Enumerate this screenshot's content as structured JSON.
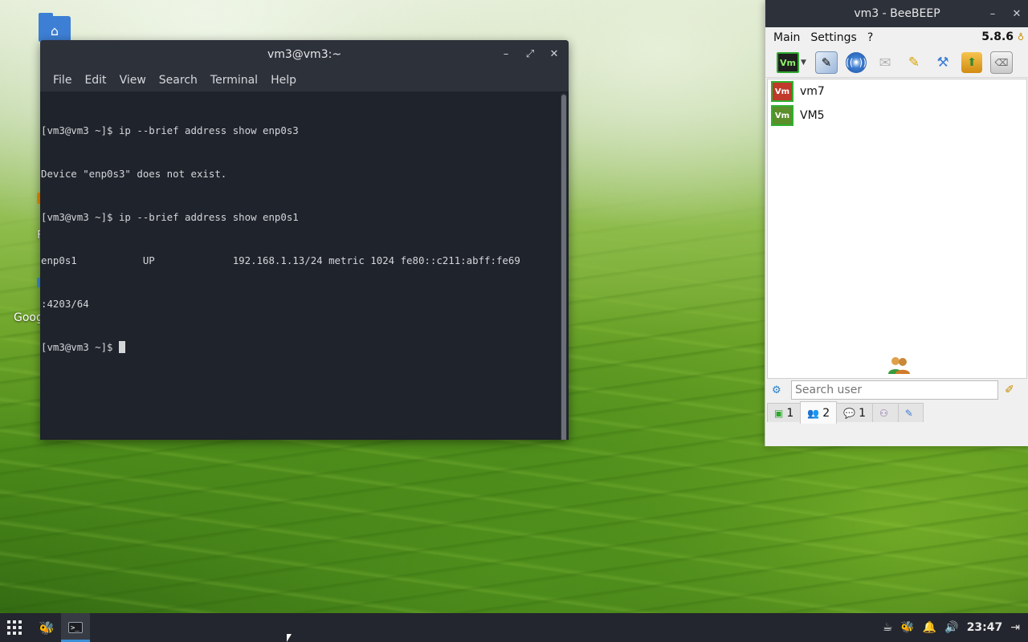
{
  "desktop": {
    "icons": [
      {
        "label": "Goog"
      },
      {
        "label": "F"
      }
    ]
  },
  "terminal": {
    "title": "vm3@vm3:~",
    "menu": [
      "File",
      "Edit",
      "View",
      "Search",
      "Terminal",
      "Help"
    ],
    "lines": [
      "[vm3@vm3 ~]$ ip --brief address show enp0s3",
      "Device \"enp0s3\" does not exist.",
      "[vm3@vm3 ~]$ ip --brief address show enp0s1",
      "enp0s1           UP             192.168.1.13/24 metric 1024 fe80::c211:abff:fe69",
      ":4203/64",
      "[vm3@vm3 ~]$ "
    ]
  },
  "beebeep": {
    "title": "vm3 - BeeBEEP",
    "menu": [
      "Main",
      "Settings",
      "?"
    ],
    "version": "5.8.6",
    "toolbar_badge": "Vm",
    "users": [
      {
        "badge": "Vm",
        "name": "vm7"
      },
      {
        "badge": "Vm",
        "name": "VM5"
      }
    ],
    "search": {
      "placeholder": "Search user"
    },
    "tabs": [
      {
        "count": "1"
      },
      {
        "count": "2"
      },
      {
        "count": "1"
      },
      {
        "count": ""
      },
      {
        "count": ""
      }
    ]
  },
  "taskbar": {
    "clock": "23:47"
  }
}
